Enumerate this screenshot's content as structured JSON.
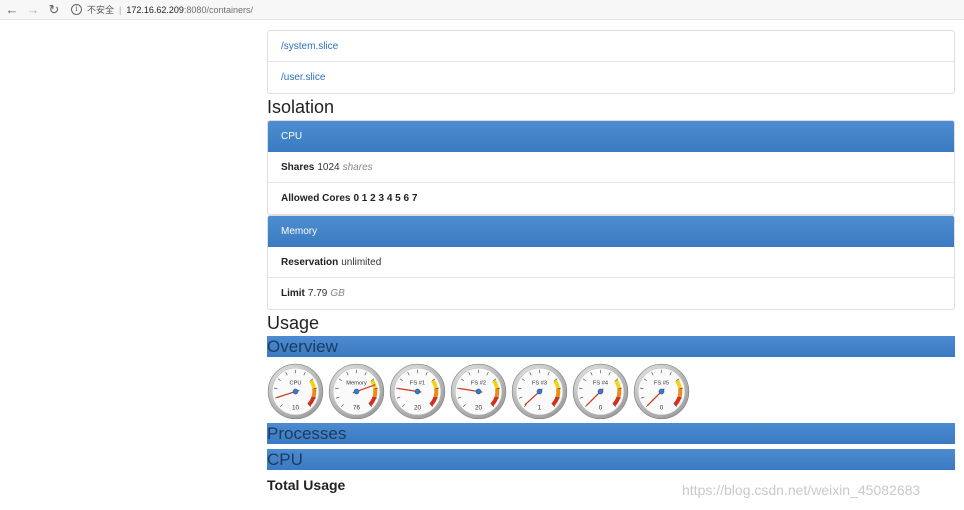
{
  "browser": {
    "back_icon": "back-arrow-icon",
    "forward_icon": "forward-arrow-icon",
    "reload_icon": "reload-icon",
    "security_label": "不安全",
    "url_host": "172.16.62.209",
    "url_rest": ":8080/containers/"
  },
  "subcontainers": [
    {
      "label": "/system.slice"
    },
    {
      "label": "/user.slice"
    }
  ],
  "isolation": {
    "title": "Isolation",
    "cpu": {
      "heading": "CPU",
      "shares_label": "Shares",
      "shares_value": "1024",
      "shares_unit": "shares",
      "cores_label": "Allowed Cores",
      "cores_value": "0 1 2 3 4 5 6 7"
    },
    "memory": {
      "heading": "Memory",
      "reservation_label": "Reservation",
      "reservation_value": "unlimited",
      "limit_label": "Limit",
      "limit_value": "7.79",
      "limit_unit": "GB"
    }
  },
  "usage": {
    "title": "Usage",
    "overview_heading": "Overview",
    "gauges": [
      {
        "label": "CPU",
        "value": 10
      },
      {
        "label": "Memory",
        "value": 76
      },
      {
        "label": "FS #1",
        "value": 20
      },
      {
        "label": "FS #2",
        "value": 20
      },
      {
        "label": "FS #3",
        "value": 1
      },
      {
        "label": "FS #4",
        "value": 0
      },
      {
        "label": "FS #5",
        "value": 0
      }
    ],
    "processes_heading": "Processes",
    "cpu_heading": "CPU",
    "total_usage": "Total Usage"
  },
  "watermark": "https://blog.csdn.net/weixin_45082683",
  "colors": {
    "panel_heading": "#3a7ac1",
    "link": "#2a6fbd",
    "needle": "#cc3a1e",
    "gauge_hub": "#3a78c8"
  }
}
